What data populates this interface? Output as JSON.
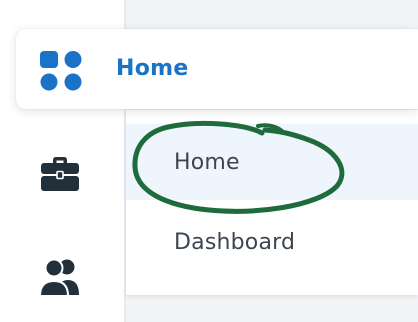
{
  "header": {
    "label": "Home",
    "icon": "grid-apps-icon",
    "accent_color": "#1a73c7"
  },
  "rail": {
    "items": [
      {
        "icon": "briefcase-icon"
      },
      {
        "icon": "users-icon"
      }
    ],
    "icon_color": "#22303c"
  },
  "submenu": {
    "items": [
      {
        "label": "Home",
        "selected": true
      },
      {
        "label": "Dashboard",
        "selected": false
      }
    ]
  },
  "annotation": {
    "type": "hand-drawn circle",
    "color": "#1e6b3b"
  }
}
